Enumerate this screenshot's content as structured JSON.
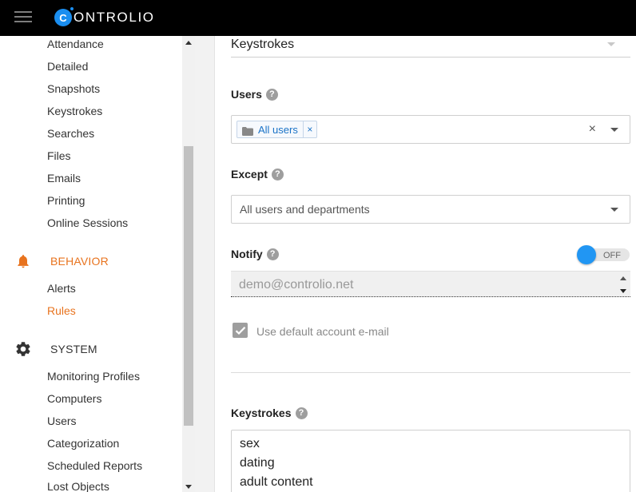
{
  "app": {
    "logo_letter": "C",
    "logo_text": "ONTROLIO",
    "brand_color": "#1a8ef0",
    "accent_color": "#e8731e"
  },
  "sidebar": {
    "items_top": [
      "Attendance",
      "Detailed",
      "Snapshots",
      "Keystrokes",
      "Searches",
      "Files",
      "Emails",
      "Printing",
      "Online Sessions"
    ],
    "behavior": {
      "label": "BEHAVIOR",
      "icon": "bell-icon",
      "items": [
        "Alerts",
        "Rules"
      ],
      "active_item": "Rules"
    },
    "system": {
      "label": "SYSTEM",
      "icon": "gear-icon",
      "items": [
        "Monitoring Profiles",
        "Computers",
        "Users",
        "Categorization",
        "Scheduled Reports",
        "Lost Objects"
      ]
    }
  },
  "form": {
    "report_type": "Keystrokes",
    "users": {
      "label": "Users",
      "chip": "All users",
      "chip_remove": "×",
      "clear": "×"
    },
    "except": {
      "label": "Except",
      "placeholder": "All users and departments"
    },
    "notify": {
      "label": "Notify",
      "toggle_state": "OFF",
      "placeholder": "demo@controlio.net"
    },
    "use_default": {
      "label": "Use default account e-mail",
      "checked": true
    },
    "keystrokes": {
      "label": "Keystrokes",
      "lines": [
        "sex",
        "dating",
        "adult content"
      ]
    },
    "help_glyph": "?"
  }
}
